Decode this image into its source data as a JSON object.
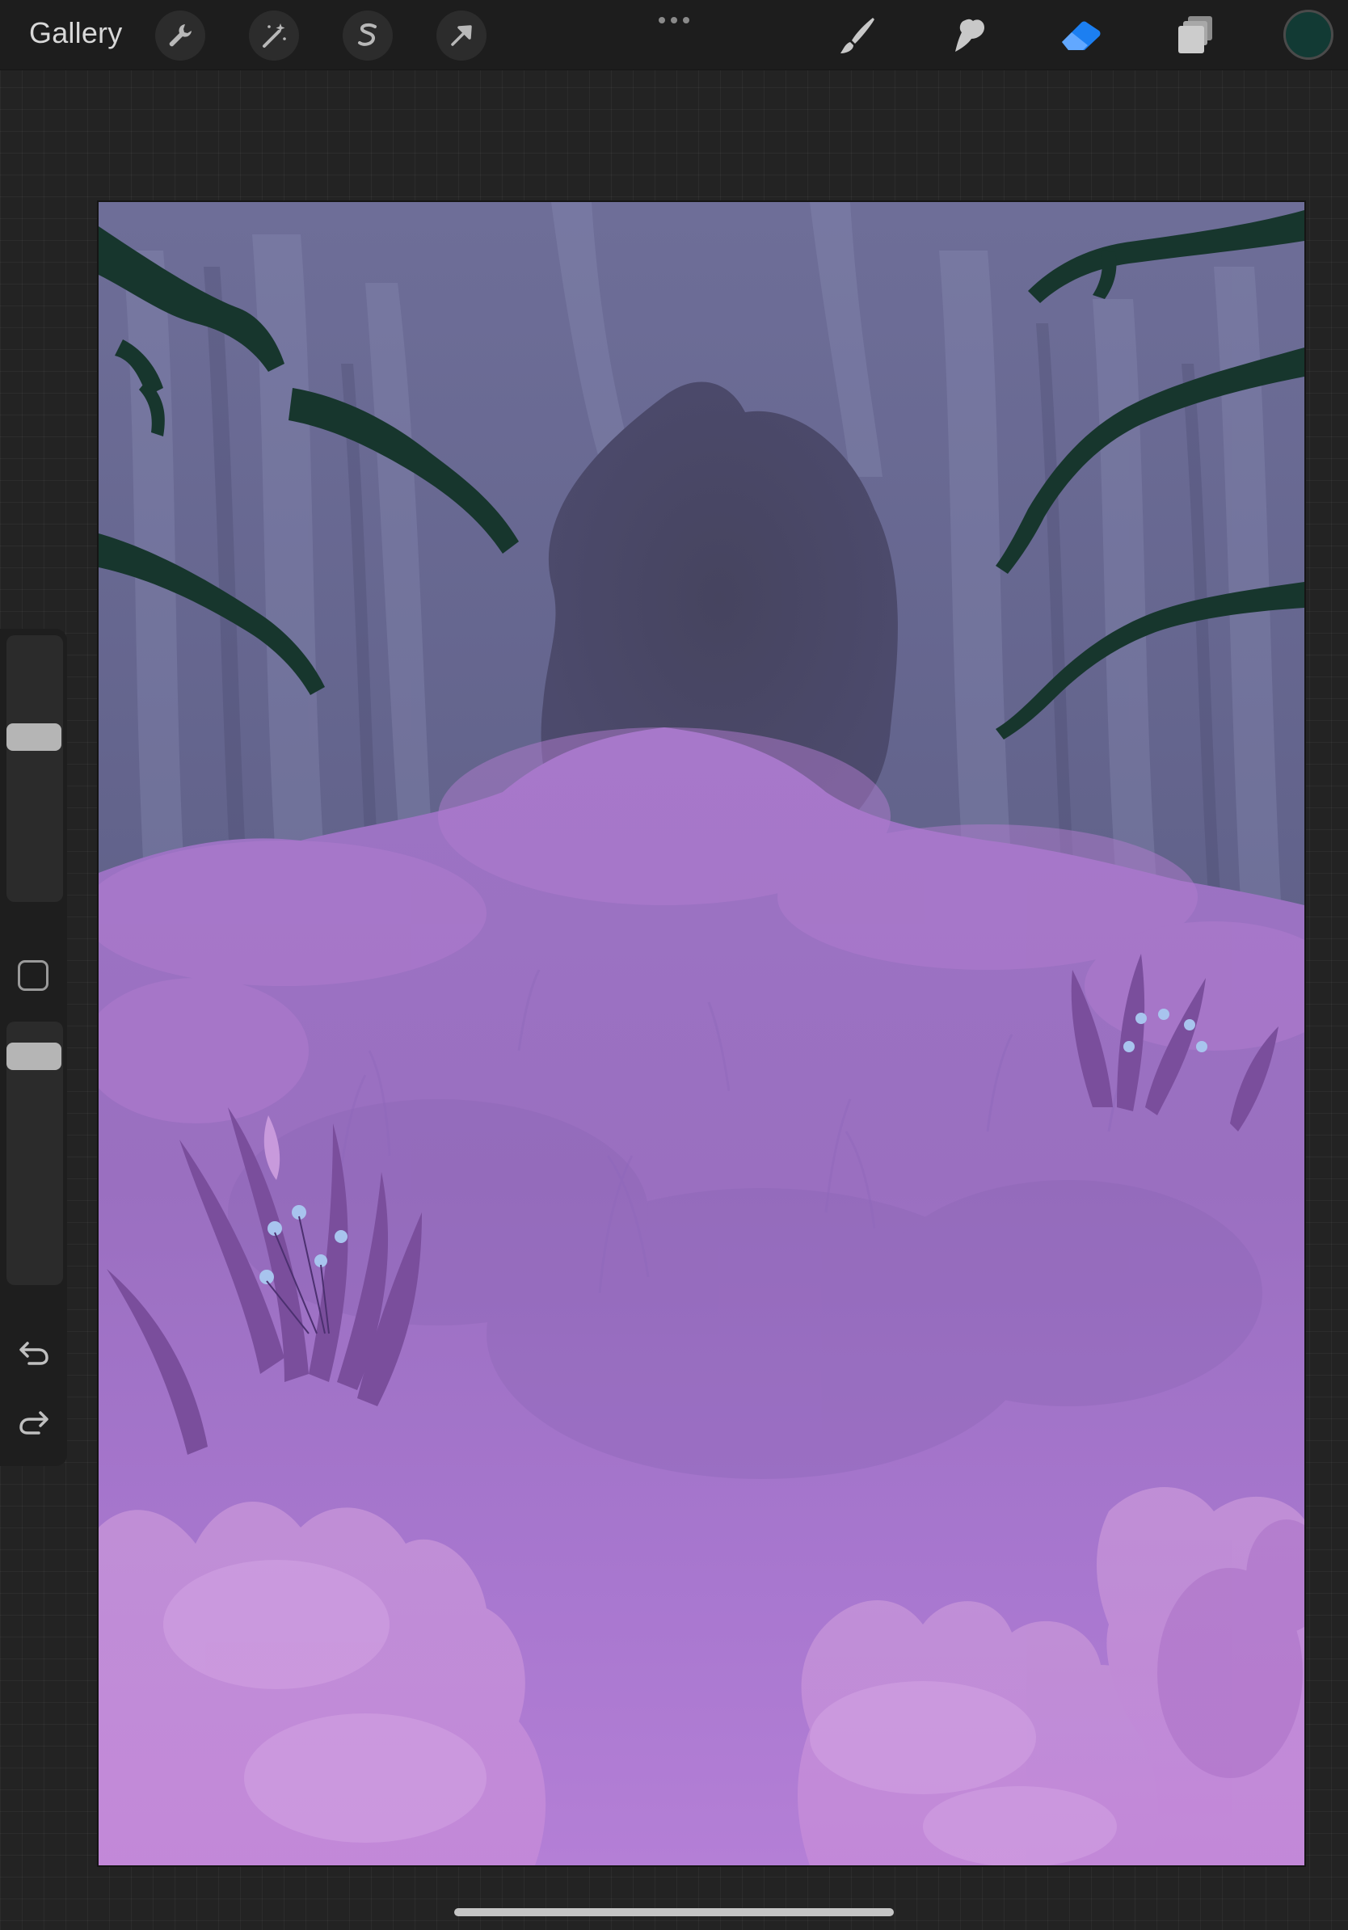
{
  "toolbar": {
    "gallery_label": "Gallery",
    "left_tools": [
      "wrench-icon",
      "magic-wand-icon",
      "selection-s-icon",
      "move-arrow-icon"
    ],
    "more_menu": "ellipsis-icon",
    "right_tools": [
      "brush-icon",
      "smudge-icon",
      "eraser-icon",
      "layers-icon"
    ],
    "active_tool": "eraser",
    "accent_color": "#1c7ff1",
    "current_color": "#123a34"
  },
  "sidebar": {
    "brush_size": 0.6,
    "brush_opacity": 0.95,
    "modify_button": "square-icon",
    "undo": "undo-icon",
    "redo": "redo-icon"
  },
  "canvas": {
    "palette": {
      "cave": "#4a4868",
      "rock": "#6a6a92",
      "moss": "#17362d",
      "grass": "#a277c4",
      "foreground": "#c48fd8"
    }
  }
}
